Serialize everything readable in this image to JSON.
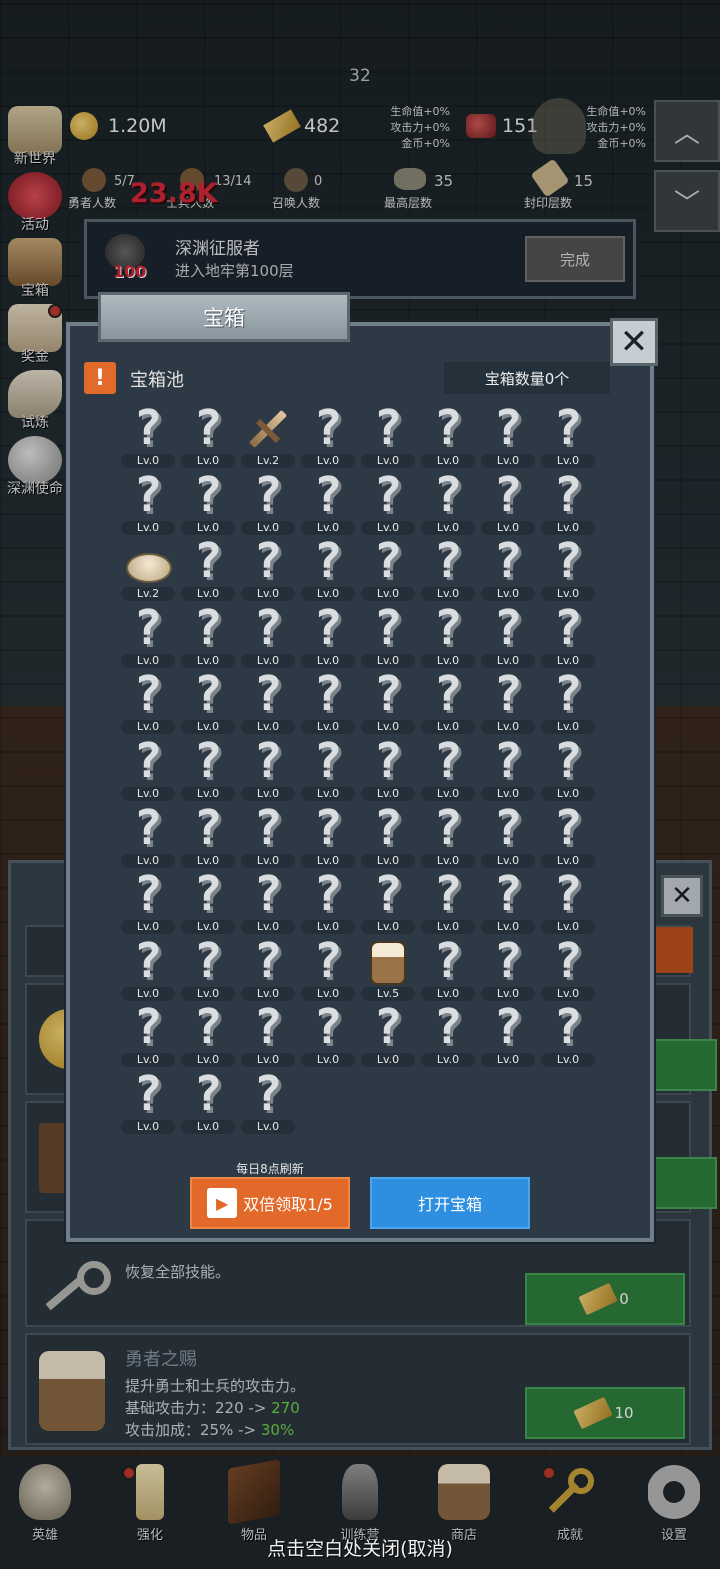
{
  "hud": {
    "floor": "32",
    "gold": "1.20M",
    "bars": "482",
    "bars_bonus": [
      "生命值+0%",
      "攻击力+0%",
      "金币+0%"
    ],
    "gems": "151",
    "gems_bonus": [
      "生命值+0%",
      "攻击力+0%",
      "金币+0%"
    ],
    "stats": [
      {
        "value": "5/7",
        "label": "勇者人数"
      },
      {
        "value": "13/14",
        "label": "士兵人数"
      },
      {
        "value": "0",
        "label": "召唤人数"
      },
      {
        "value": "35",
        "label": "最高层数"
      },
      {
        "value": "15",
        "label": "封印层数"
      }
    ],
    "damage_popup": "23.8K"
  },
  "side_menu": [
    "新世界",
    "活动",
    "宝箱",
    "奖金",
    "试炼",
    "深渊使命"
  ],
  "quest": {
    "title": "深渊征服者",
    "desc": "进入地牢第100层",
    "badge": "100",
    "button": "完成"
  },
  "dialog": {
    "tab_title": "宝箱",
    "pool_label": "宝箱池",
    "chest_count": "宝箱数量0个",
    "refresh_note": "每日8点刷新",
    "double_button": "双倍领取1/5",
    "open_button": "打开宝箱",
    "items": [
      "Lv.0",
      "Lv.0",
      "Lv.2",
      "Lv.0",
      "Lv.0",
      "Lv.0",
      "Lv.0",
      "Lv.0",
      "Lv.0",
      "Lv.0",
      "Lv.0",
      "Lv.0",
      "Lv.0",
      "Lv.0",
      "Lv.0",
      "Lv.0",
      "Lv.2",
      "Lv.0",
      "Lv.0",
      "Lv.0",
      "Lv.0",
      "Lv.0",
      "Lv.0",
      "Lv.0",
      "Lv.0",
      "Lv.0",
      "Lv.0",
      "Lv.0",
      "Lv.0",
      "Lv.0",
      "Lv.0",
      "Lv.0",
      "Lv.0",
      "Lv.0",
      "Lv.0",
      "Lv.0",
      "Lv.0",
      "Lv.0",
      "Lv.0",
      "Lv.0",
      "Lv.0",
      "Lv.0",
      "Lv.0",
      "Lv.0",
      "Lv.0",
      "Lv.0",
      "Lv.0",
      "Lv.0",
      "Lv.0",
      "Lv.0",
      "Lv.0",
      "Lv.0",
      "Lv.0",
      "Lv.0",
      "Lv.0",
      "Lv.0",
      "Lv.0",
      "Lv.0",
      "Lv.0",
      "Lv.0",
      "Lv.0",
      "Lv.0",
      "Lv.0",
      "Lv.0",
      "Lv.0",
      "Lv.0",
      "Lv.0",
      "Lv.0",
      "Lv.5",
      "Lv.0",
      "Lv.0",
      "Lv.0",
      "Lv.0",
      "Lv.0",
      "Lv.0",
      "Lv.0",
      "Lv.0",
      "Lv.0",
      "Lv.0",
      "Lv.0",
      "Lv.0",
      "Lv.0",
      "Lv.0"
    ],
    "revealed": {
      "2": "sword",
      "16": "bread",
      "68": "beer"
    }
  },
  "lower_panel": {
    "key_row_desc": "恢复全部技能。",
    "key_row_cost": "0",
    "beer_row_title": "勇者之赐",
    "beer_row_desc": "提升勇士和士兵的攻击力。",
    "beer_row_attack_label": "基础攻击力：220 ->",
    "beer_row_attack_new": "270",
    "beer_row_bonus_label": "攻击加成：25% ->",
    "beer_row_bonus_new": "30%",
    "beer_row_cost": "10"
  },
  "bottom_nav": [
    "英雄",
    "强化",
    "物品",
    "训练营",
    "商店",
    "成就",
    "设置"
  ],
  "close_hint": "点击空白处关闭(取消)",
  "colors": {
    "orange_button": "#e2692a",
    "blue_button": "#2e8fe0",
    "green_button": "#2e7f3c",
    "highlight_green": "#6fd14a",
    "damage_red": "#d6283a"
  }
}
